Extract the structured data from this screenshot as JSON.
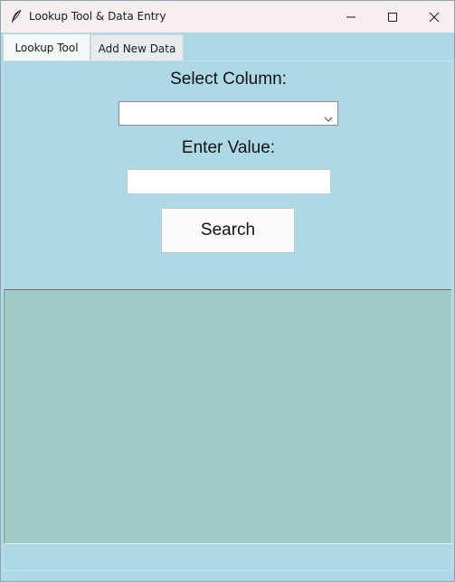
{
  "window": {
    "title": "Lookup Tool & Data Entry",
    "icon": "feather-icon"
  },
  "tabs": [
    {
      "label": "Lookup Tool",
      "active": true
    },
    {
      "label": "Add New Data",
      "active": false
    }
  ],
  "lookup": {
    "select_column_label": "Select Column:",
    "column_dropdown": {
      "selected": "",
      "icon": "chevron-down-icon"
    },
    "enter_value_label": "Enter Value:",
    "value_input": {
      "value": "",
      "placeholder": ""
    },
    "search_button_label": "Search"
  },
  "results": {
    "content": ""
  },
  "colors": {
    "window_bg": "#add8e6",
    "results_bg": "#a1cbc7",
    "titlebar_bg": "#f7eef0"
  }
}
